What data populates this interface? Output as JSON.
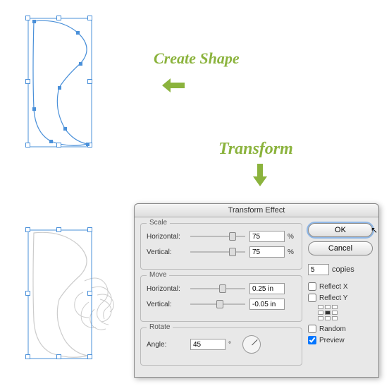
{
  "labels": {
    "create_shape": "Create Shape",
    "transform": "Transform"
  },
  "dialog": {
    "title": "Transform Effect",
    "scale": {
      "group_label": "Scale",
      "horizontal_label": "Horizontal:",
      "horizontal_value": "75",
      "horizontal_unit": "%",
      "vertical_label": "Vertical:",
      "vertical_value": "75",
      "vertical_unit": "%"
    },
    "move": {
      "group_label": "Move",
      "horizontal_label": "Horizontal:",
      "horizontal_value": "0.25 in",
      "vertical_label": "Vertical:",
      "vertical_value": "-0.05 in"
    },
    "rotate": {
      "group_label": "Rotate",
      "angle_label": "Angle:",
      "angle_value": "45",
      "angle_unit": "°"
    },
    "ok": "OK",
    "cancel": "Cancel",
    "copies_value": "5",
    "copies_label": "copies",
    "reflect_x": "Reflect X",
    "reflect_y": "Reflect Y",
    "random": "Random",
    "preview": "Preview",
    "preview_checked": true
  }
}
